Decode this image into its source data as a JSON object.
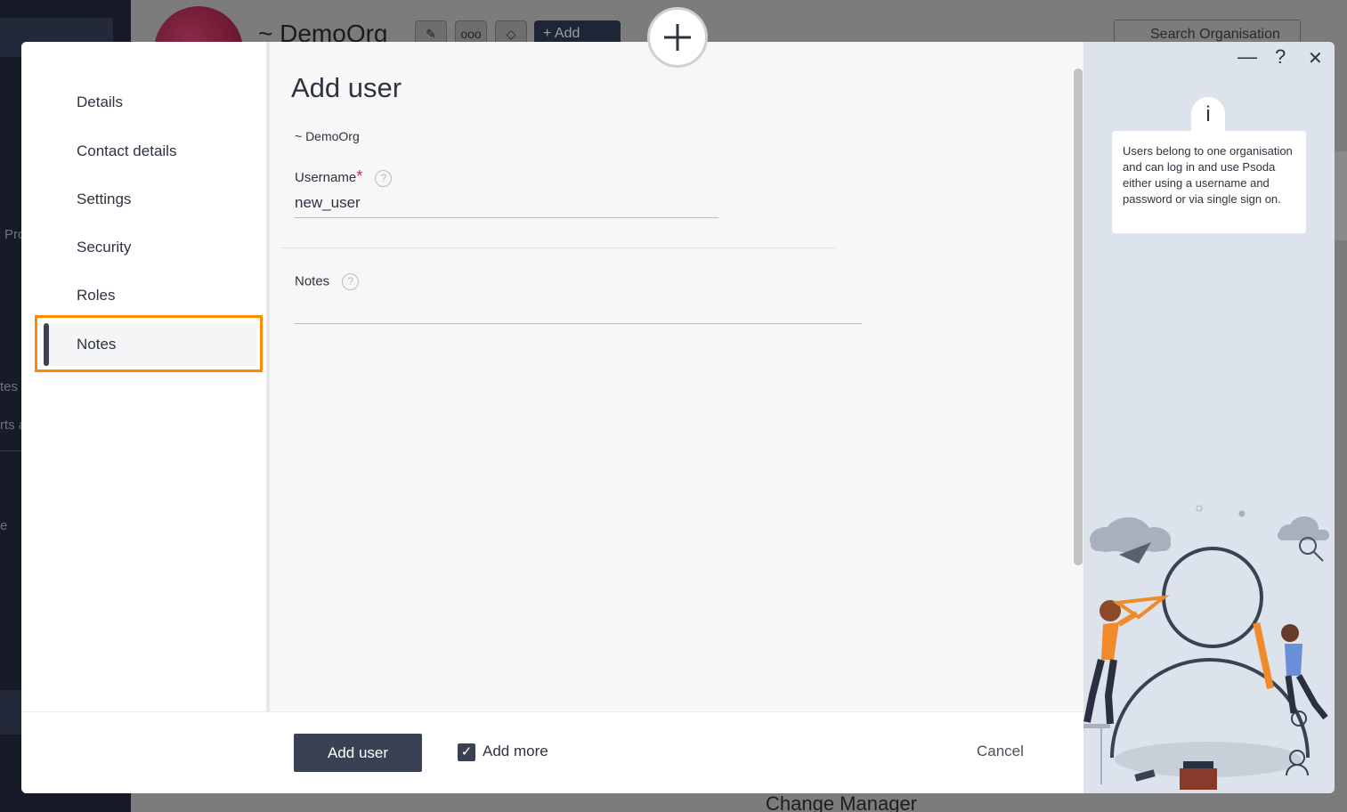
{
  "background": {
    "org_title": "~ DemoOrg",
    "add_button": "+ Add",
    "search_placeholder": "Search Organisation",
    "bottom_text": "Change Manager",
    "sidebar_fragments": [
      "Pro",
      "tes",
      "rts a",
      "e"
    ]
  },
  "modal": {
    "nav": {
      "items": [
        {
          "label": "Details"
        },
        {
          "label": "Contact details"
        },
        {
          "label": "Settings"
        },
        {
          "label": "Security"
        },
        {
          "label": "Roles"
        },
        {
          "label": "Notes"
        }
      ],
      "active": "Notes"
    },
    "title": "Add user",
    "org": "~ DemoOrg",
    "fields": {
      "username": {
        "label": "Username",
        "required_mark": "*",
        "value": "new_user"
      },
      "notes": {
        "label": "Notes",
        "value": ""
      }
    },
    "help_glyph": "?",
    "footer": {
      "submit_label": "Add user",
      "add_more_label": "Add more",
      "add_more_checked": true,
      "cancel_label": "Cancel"
    },
    "info_panel": {
      "info_glyph": "i",
      "text": "Users belong to one organisation and can log in and use Psoda either using a username and password or via single sign on.",
      "minimize_glyph": "—",
      "help_glyph": "?",
      "close_glyph": "✕"
    }
  },
  "colors": {
    "accent_dark": "#3a4152",
    "highlight": "#ff8a00",
    "required": "#e0233b",
    "info_bg": "#dde3ec"
  }
}
